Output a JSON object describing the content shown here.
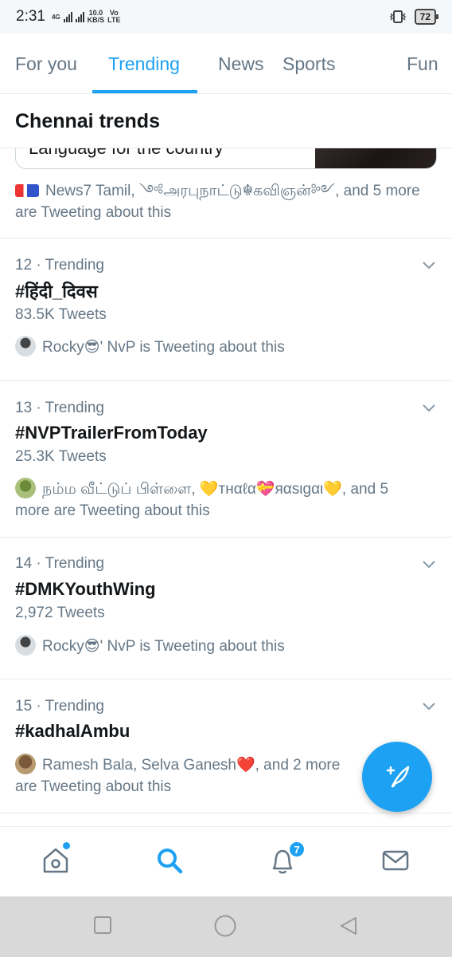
{
  "status_bar": {
    "time": "2:31",
    "net_type": "4G",
    "speed_value": "10.0",
    "speed_unit": "KB/S",
    "volte_top": "Vo",
    "volte_bottom": "LTE",
    "battery": "72"
  },
  "tabs": [
    {
      "label": "For you",
      "active": false
    },
    {
      "label": "Trending",
      "active": true
    },
    {
      "label": "News",
      "active": false
    },
    {
      "label": "Sports",
      "active": false
    },
    {
      "label": "Fun",
      "active": false
    }
  ],
  "section": {
    "title": "Chennai trends"
  },
  "peek_card": {
    "text": "Language for the country",
    "context": "News7 Tamil, ༺அரபுநாட்டு☬கவிஞன்༻, and 5 more are Tweeting about this"
  },
  "trends": [
    {
      "meta": "12 · Trending",
      "name": "#हिंदी_दिवस",
      "count": "83.5K Tweets",
      "context": "Rocky😎' NvP is Tweeting about this"
    },
    {
      "meta": "13 · Trending",
      "name": "#NVPTrailerFromToday",
      "count": "25.3K Tweets",
      "context": "நம்ம வீட்டுப் பிள்ளை, 💛тнαℓα💝яαsιgαι💛, and 5 more are Tweeting about this"
    },
    {
      "meta": "14 · Trending",
      "name": "#DMKYouthWing",
      "count": "2,972 Tweets",
      "context": "Rocky😎' NvP is Tweeting about this"
    },
    {
      "meta": "15 · Trending",
      "name": "#kadhalAmbu",
      "count": "",
      "context": "Ramesh Bala, Selva Ganesh❤️, and 2 more are Tweeting about this"
    }
  ],
  "bottom_nav": {
    "notifications_badge": "7"
  },
  "colors": {
    "accent": "#1da1f2",
    "secondary_text": "#657786",
    "primary_text": "#14171a"
  }
}
